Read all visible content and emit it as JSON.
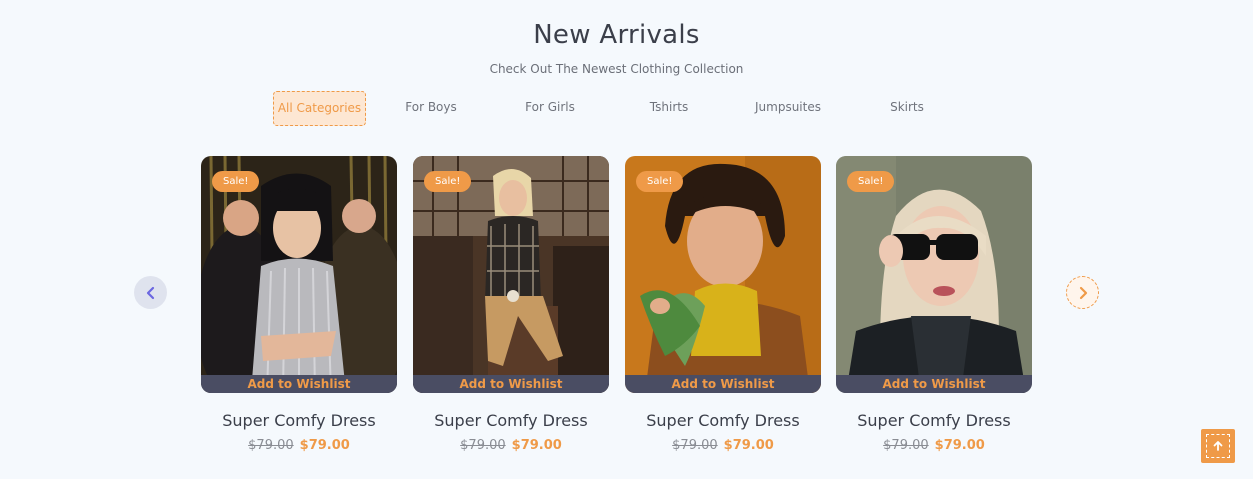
{
  "header": {
    "title": "New Arrivals",
    "subtitle": "Check Out The Newest Clothing Collection"
  },
  "tabs": [
    {
      "label": "All Categories",
      "active": true
    },
    {
      "label": "For Boys",
      "active": false
    },
    {
      "label": "For Girls",
      "active": false
    },
    {
      "label": "Tshirts",
      "active": false
    },
    {
      "label": "Jumpsuites",
      "active": false
    },
    {
      "label": "Skirts",
      "active": false
    }
  ],
  "products": [
    {
      "badge": "Sale!",
      "wishlist": "Add to Wishlist",
      "name": "Super Comfy Dress",
      "old_price": "$79.00",
      "price": "$79.00"
    },
    {
      "badge": "Sale!",
      "wishlist": "Add to Wishlist",
      "name": "Super Comfy Dress",
      "old_price": "$79.00",
      "price": "$79.00"
    },
    {
      "badge": "Sale!",
      "wishlist": "Add to Wishlist",
      "name": "Super Comfy Dress",
      "old_price": "$79.00",
      "price": "$79.00"
    },
    {
      "badge": "Sale!",
      "wishlist": "Add to Wishlist",
      "name": "Super Comfy Dress",
      "old_price": "$79.00",
      "price": "$79.00"
    }
  ],
  "icons": {
    "prev": "chevron-left-icon",
    "next": "chevron-right-icon",
    "scroll_top": "arrow-up-icon"
  },
  "colors": {
    "accent": "#ef9a48",
    "background": "#f5f9fd",
    "text": "#3b3f4a",
    "wishlist_bar": "#4a4d63"
  }
}
